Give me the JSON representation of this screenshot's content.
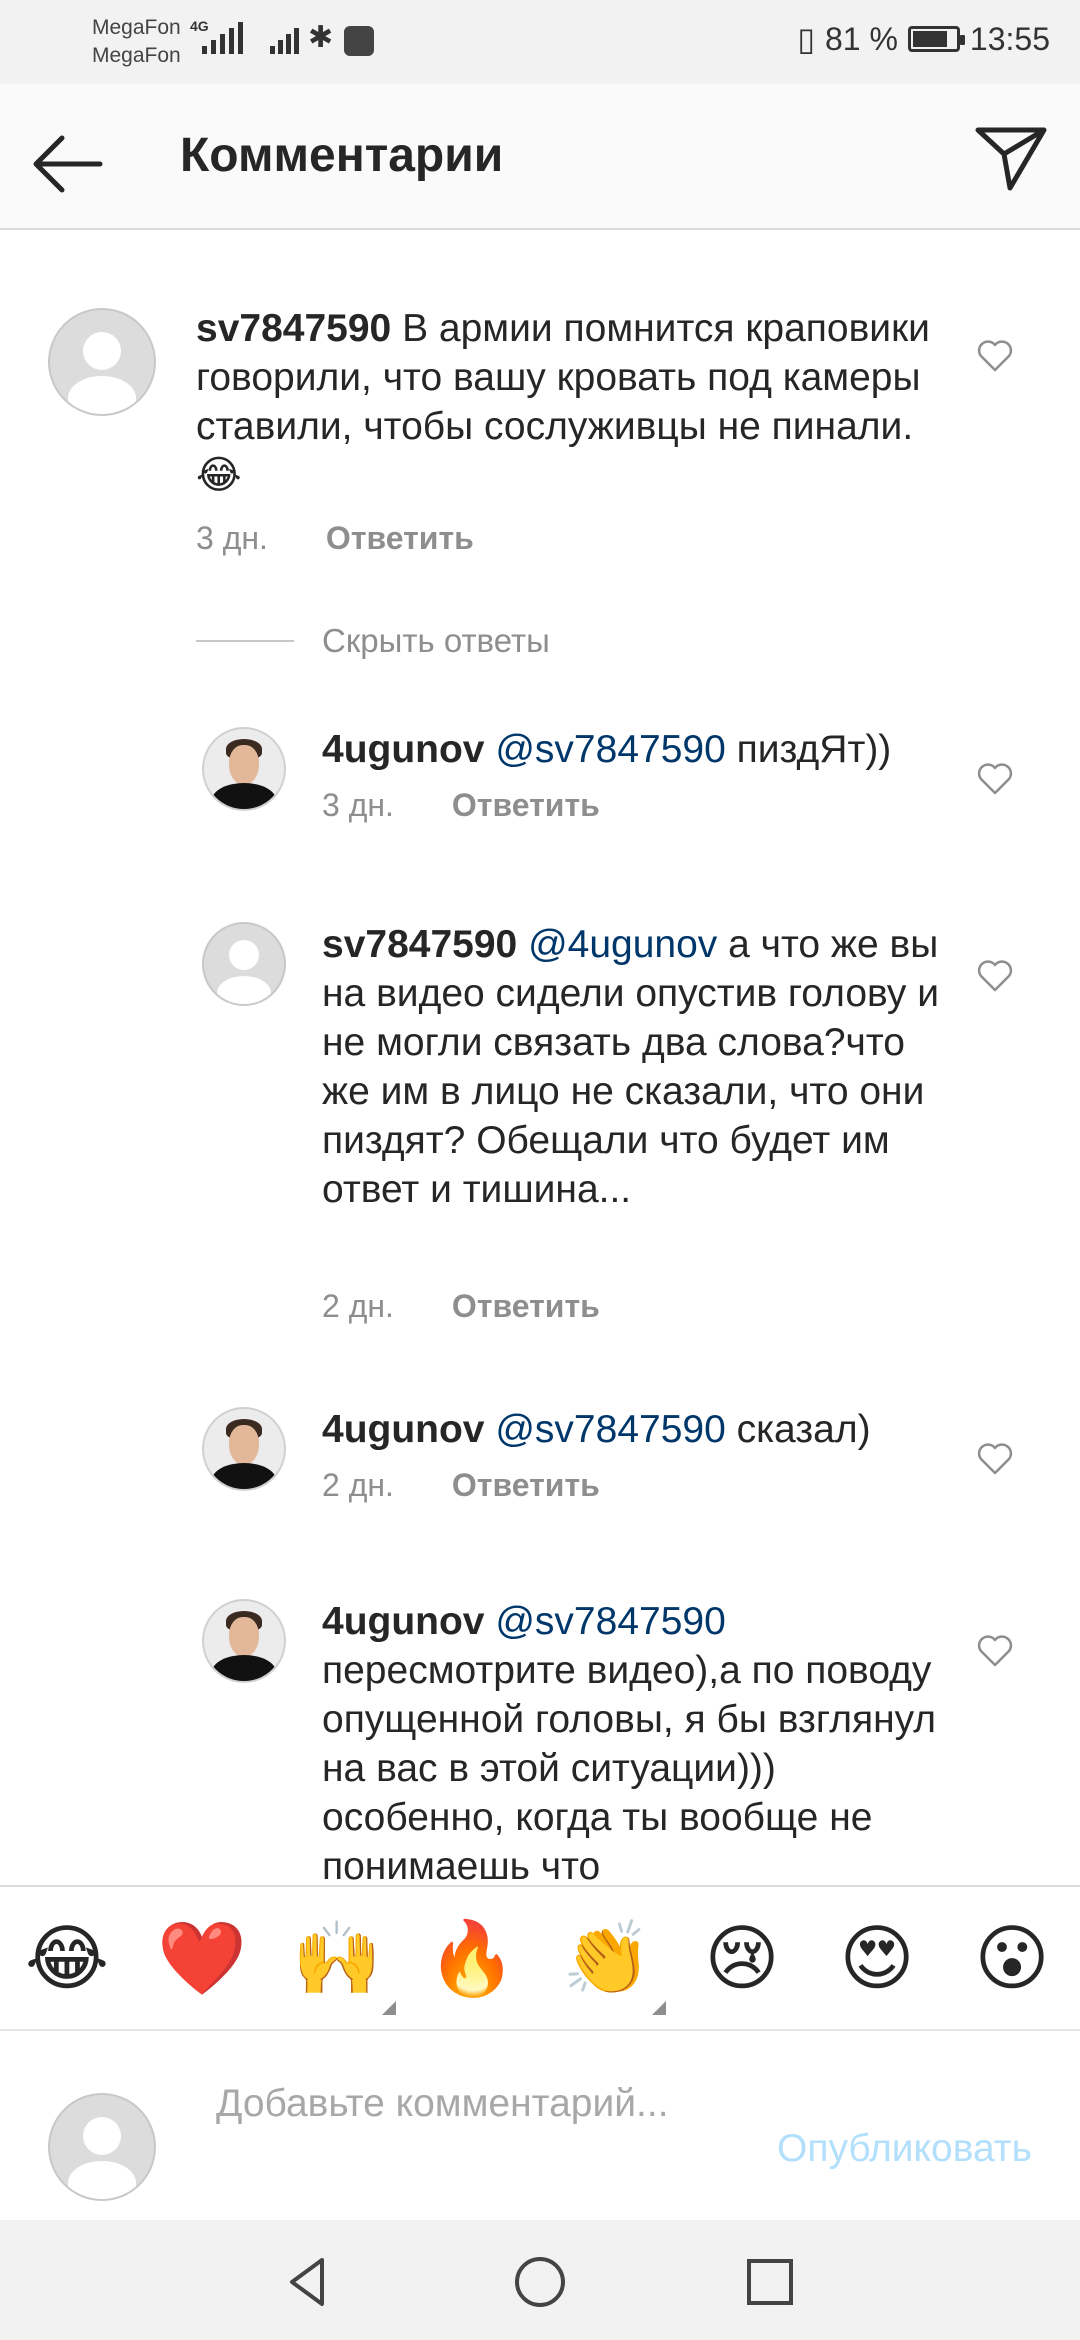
{
  "status_bar": {
    "carrier1": "MegaFon",
    "carrier2": "MegaFon",
    "network": "4G",
    "battery": "81 %",
    "battery_level": 0.81,
    "time": "13:55"
  },
  "header": {
    "title": "Комментарии"
  },
  "comments": [
    {
      "username": "sv7847590",
      "text": "В армии помнится краповики говорили, что вашу кровать под камеры ставили, чтобы сослуживцы не пинали. 😂",
      "time": "3 дн.",
      "reply_label": "Ответить"
    }
  ],
  "hide_replies": "Скрыть ответы",
  "replies": [
    {
      "username": "4ugunov",
      "mention": "@sv7847590",
      "text": "пиздЯт))",
      "time": "3 дн.",
      "reply_label": "Ответить"
    },
    {
      "username": "sv7847590",
      "mention": "@4ugunov",
      "text": "а что же вы на видео сидели опустив голову и не могли связать два слова?что же им в лицо не сказали, что они пиздят? Обещали что будет им ответ и тишина...",
      "time": "2 дн.",
      "reply_label": "Ответить"
    },
    {
      "username": "4ugunov",
      "mention": "@sv7847590",
      "text": "сказал)",
      "time": "2 дн.",
      "reply_label": "Ответить"
    },
    {
      "username": "4ugunov",
      "mention": "@sv7847590",
      "text": "пересмотрите видео),а по поводу опущенной головы, я бы взглянул на вас в этой ситуации))) особенно, когда ты вообще не понимаешь что"
    }
  ],
  "emoji_bar": [
    "😂",
    "❤️",
    "🙌",
    "🔥",
    "👏",
    "😢",
    "😍",
    "😮"
  ],
  "add_comment": {
    "placeholder": "Добавьте комментарий...",
    "publish_label": "Опубликовать"
  }
}
